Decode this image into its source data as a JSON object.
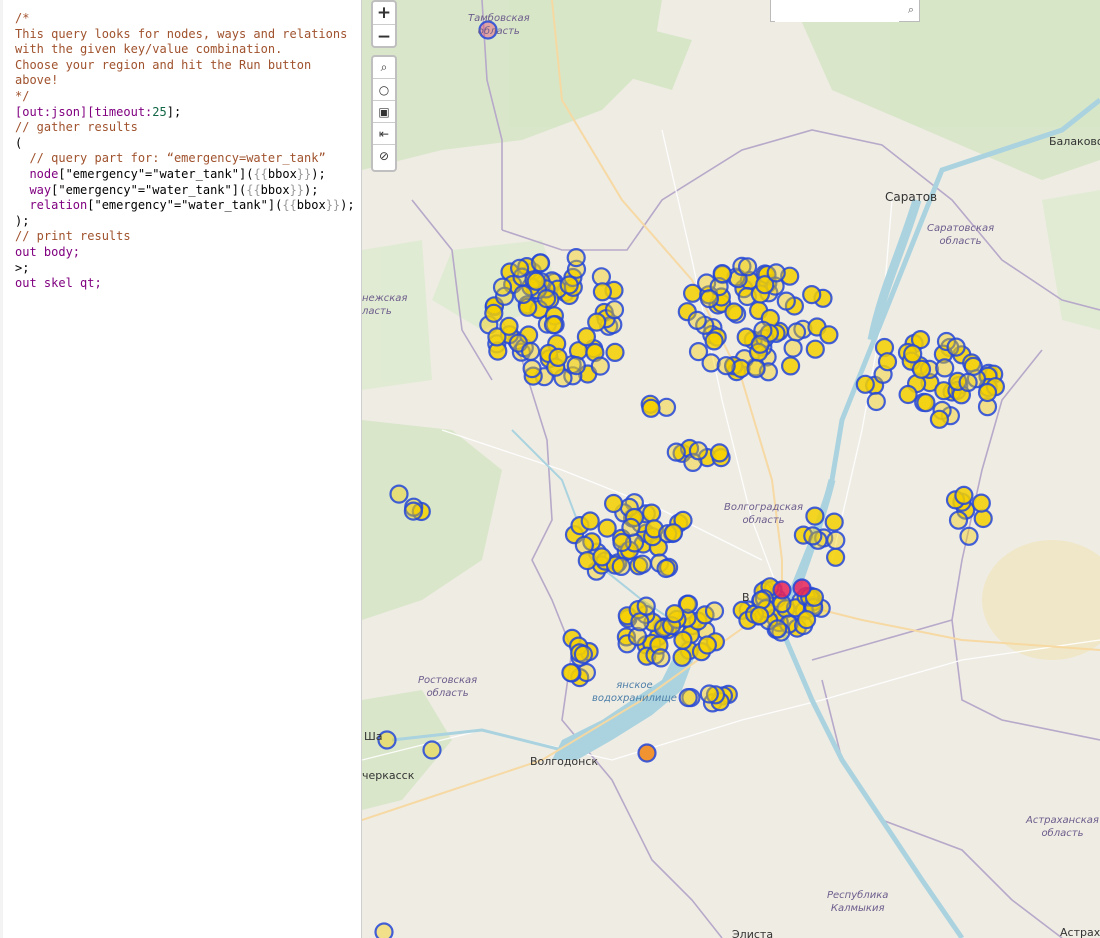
{
  "editor": {
    "lines": [
      [
        {
          "t": "/*",
          "c": "comment"
        }
      ],
      [
        {
          "t": "This query looks for nodes, ways and relations",
          "c": "comment"
        }
      ],
      [
        {
          "t": "with the given key/value combination.",
          "c": "comment"
        }
      ],
      [
        {
          "t": "Choose your region and hit the Run button above!",
          "c": "comment"
        }
      ],
      [
        {
          "t": "*/",
          "c": "comment"
        }
      ],
      [
        {
          "t": "[out:json][timeout:",
          "c": "keyword"
        },
        {
          "t": "25",
          "c": "number"
        },
        {
          "t": "];",
          "c": "plain"
        }
      ],
      [
        {
          "t": "// gather results",
          "c": "comment"
        }
      ],
      [
        {
          "t": "(",
          "c": "plain"
        }
      ],
      [
        {
          "t": "  // query part for: “emergency=water_tank”",
          "c": "comment"
        }
      ],
      [
        {
          "t": "  node",
          "c": "keyword"
        },
        {
          "t": "[\"emergency\"=\"water_tank\"]",
          "c": "string"
        },
        {
          "t": "(",
          "c": "plain"
        },
        {
          "t": "{{",
          "c": "brace"
        },
        {
          "t": "bbox",
          "c": "plain"
        },
        {
          "t": "}}",
          "c": "brace"
        },
        {
          "t": ");",
          "c": "plain"
        }
      ],
      [
        {
          "t": "  way",
          "c": "keyword"
        },
        {
          "t": "[\"emergency\"=\"water_tank\"]",
          "c": "string"
        },
        {
          "t": "(",
          "c": "plain"
        },
        {
          "t": "{{",
          "c": "brace"
        },
        {
          "t": "bbox",
          "c": "plain"
        },
        {
          "t": "}}",
          "c": "brace"
        },
        {
          "t": ");",
          "c": "plain"
        }
      ],
      [
        {
          "t": "  relation",
          "c": "keyword"
        },
        {
          "t": "[\"emergency\"=\"water_tank\"]",
          "c": "string"
        },
        {
          "t": "(",
          "c": "plain"
        },
        {
          "t": "{{",
          "c": "brace"
        },
        {
          "t": "bbox",
          "c": "plain"
        },
        {
          "t": "}}",
          "c": "brace"
        },
        {
          "t": ");",
          "c": "plain"
        }
      ],
      [
        {
          "t": ");",
          "c": "plain"
        }
      ],
      [
        {
          "t": "// print results",
          "c": "comment"
        }
      ],
      [
        {
          "t": "out body;",
          "c": "keyword"
        }
      ],
      [
        {
          "t": ">;",
          "c": "plain"
        }
      ],
      [
        {
          "t": "out skel qt;",
          "c": "keyword"
        }
      ]
    ]
  },
  "map": {
    "controls": {
      "zoom_in": "+",
      "zoom_out": "−",
      "tools": [
        {
          "name": "zoom-to-data-icon",
          "glyph": "⌕"
        },
        {
          "name": "locate-icon",
          "glyph": "○"
        },
        {
          "name": "export-image-icon",
          "glyph": "▣"
        },
        {
          "name": "toggle-data-icon",
          "glyph": "⇤"
        },
        {
          "name": "clear-icon",
          "glyph": "⊘"
        }
      ]
    },
    "search_placeholder": "",
    "labels": {
      "balakovo": "Балаково",
      "saratov": "Саратов",
      "saratov_region_1": "Саратовская",
      "saratov_region_2": "область",
      "voronezh_region_1": "нежская",
      "voronezh_region_2": "ласть",
      "volgograd_region_1": "Волгоградская",
      "volgograd_region_2": "область",
      "volgograd_city": "В",
      "rostov_region_1": "Ростовская",
      "rostov_region_2": "область",
      "reservoir_1": "янское",
      "reservoir_2": "водохранилище",
      "volgodonsk": "Волгодонск",
      "shakhty": "Ша",
      "novocherkassk": "черкасск",
      "astrakhan_region_1": "Астраханская",
      "astrakhan_region_2": "область",
      "kalmykia_1": "Республика",
      "kalmykia_2": "Калмыкия",
      "elista": "Элиста",
      "astrakhan_city": "Астрах",
      "tambov_region_1": "Тамбовская",
      "tambov_region_2": "область"
    },
    "colors": {
      "marker_stroke": "#2346d9",
      "marker_fill": "#f5d000",
      "marker_highlight": "#e8245a",
      "marker_orange": "#f08a1c",
      "water": "#aad3df"
    }
  }
}
